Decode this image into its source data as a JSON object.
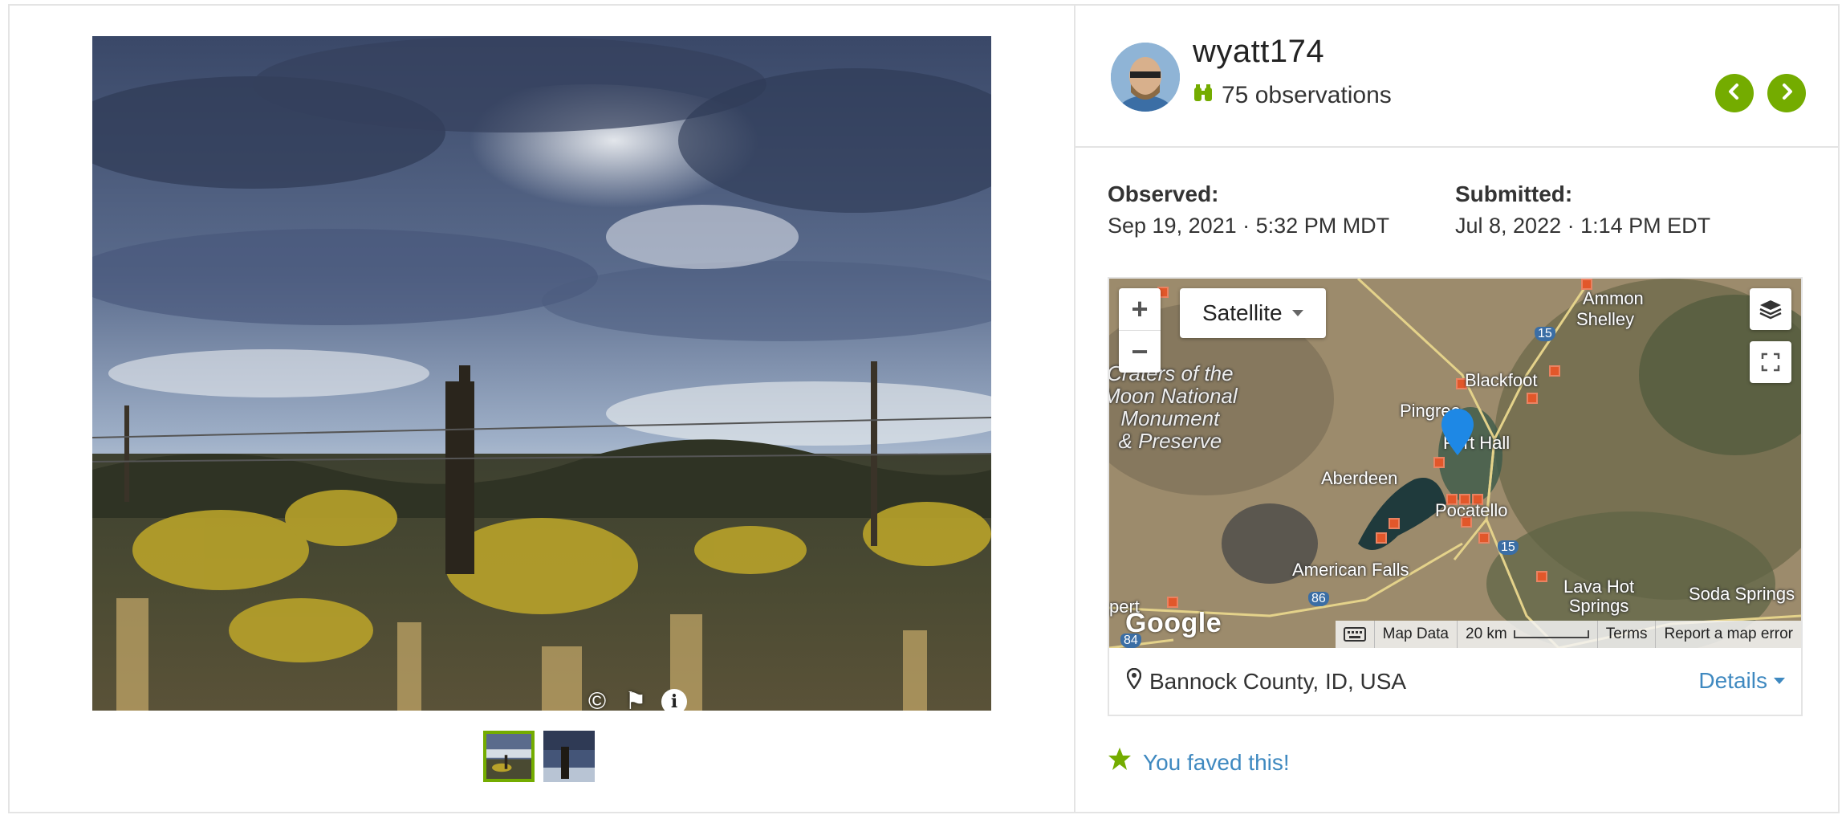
{
  "user": {
    "username": "wyatt174",
    "observations_label": "75 observations"
  },
  "nav": {
    "prev_icon": "chevron-left-icon",
    "next_icon": "chevron-right-icon"
  },
  "photo": {
    "tools": [
      {
        "name": "copyright-icon",
        "glyph": "©"
      },
      {
        "name": "flag-icon",
        "glyph": "⚑"
      },
      {
        "name": "info-icon",
        "glyph": "i"
      }
    ],
    "thumbnails": 2
  },
  "observed": {
    "label": "Observed:",
    "value": "Sep 19, 2021 · 5:32 PM MDT"
  },
  "submitted": {
    "label": "Submitted:",
    "value": "Jul 8, 2022 · 1:14 PM EDT"
  },
  "map": {
    "zoom_in": "+",
    "zoom_out": "−",
    "map_type": "Satellite",
    "google": "Google",
    "attribution": {
      "map_data": "Map Data",
      "scale": "20 km",
      "terms": "Terms",
      "report": "Report a map error"
    },
    "labels": {
      "ammon": "Ammon",
      "shelley": "Shelley",
      "blackfoot": "Blackfoot",
      "pingree": "Pingree",
      "fort_hall": "Fort Hall",
      "aberdeen": "Aberdeen",
      "pocatello": "Pocatello",
      "american_falls": "American Falls",
      "lava_hot_springs": "Lava Hot\nSprings",
      "soda_springs": "Soda Springs",
      "craters": "Craters of the\nMoon National\nMonument\n& Preserve",
      "pert": "pert",
      "i15a": "15",
      "i15b": "15",
      "i86": "86",
      "i84": "84"
    }
  },
  "place": {
    "text": "Bannock County, ID, USA",
    "details": "Details"
  },
  "faved": {
    "text": "You faved this!"
  },
  "colors": {
    "accent": "#74ac00",
    "link": "#3f89c0",
    "obs_marker": "#e2572a",
    "pin": "#1e88e5"
  }
}
